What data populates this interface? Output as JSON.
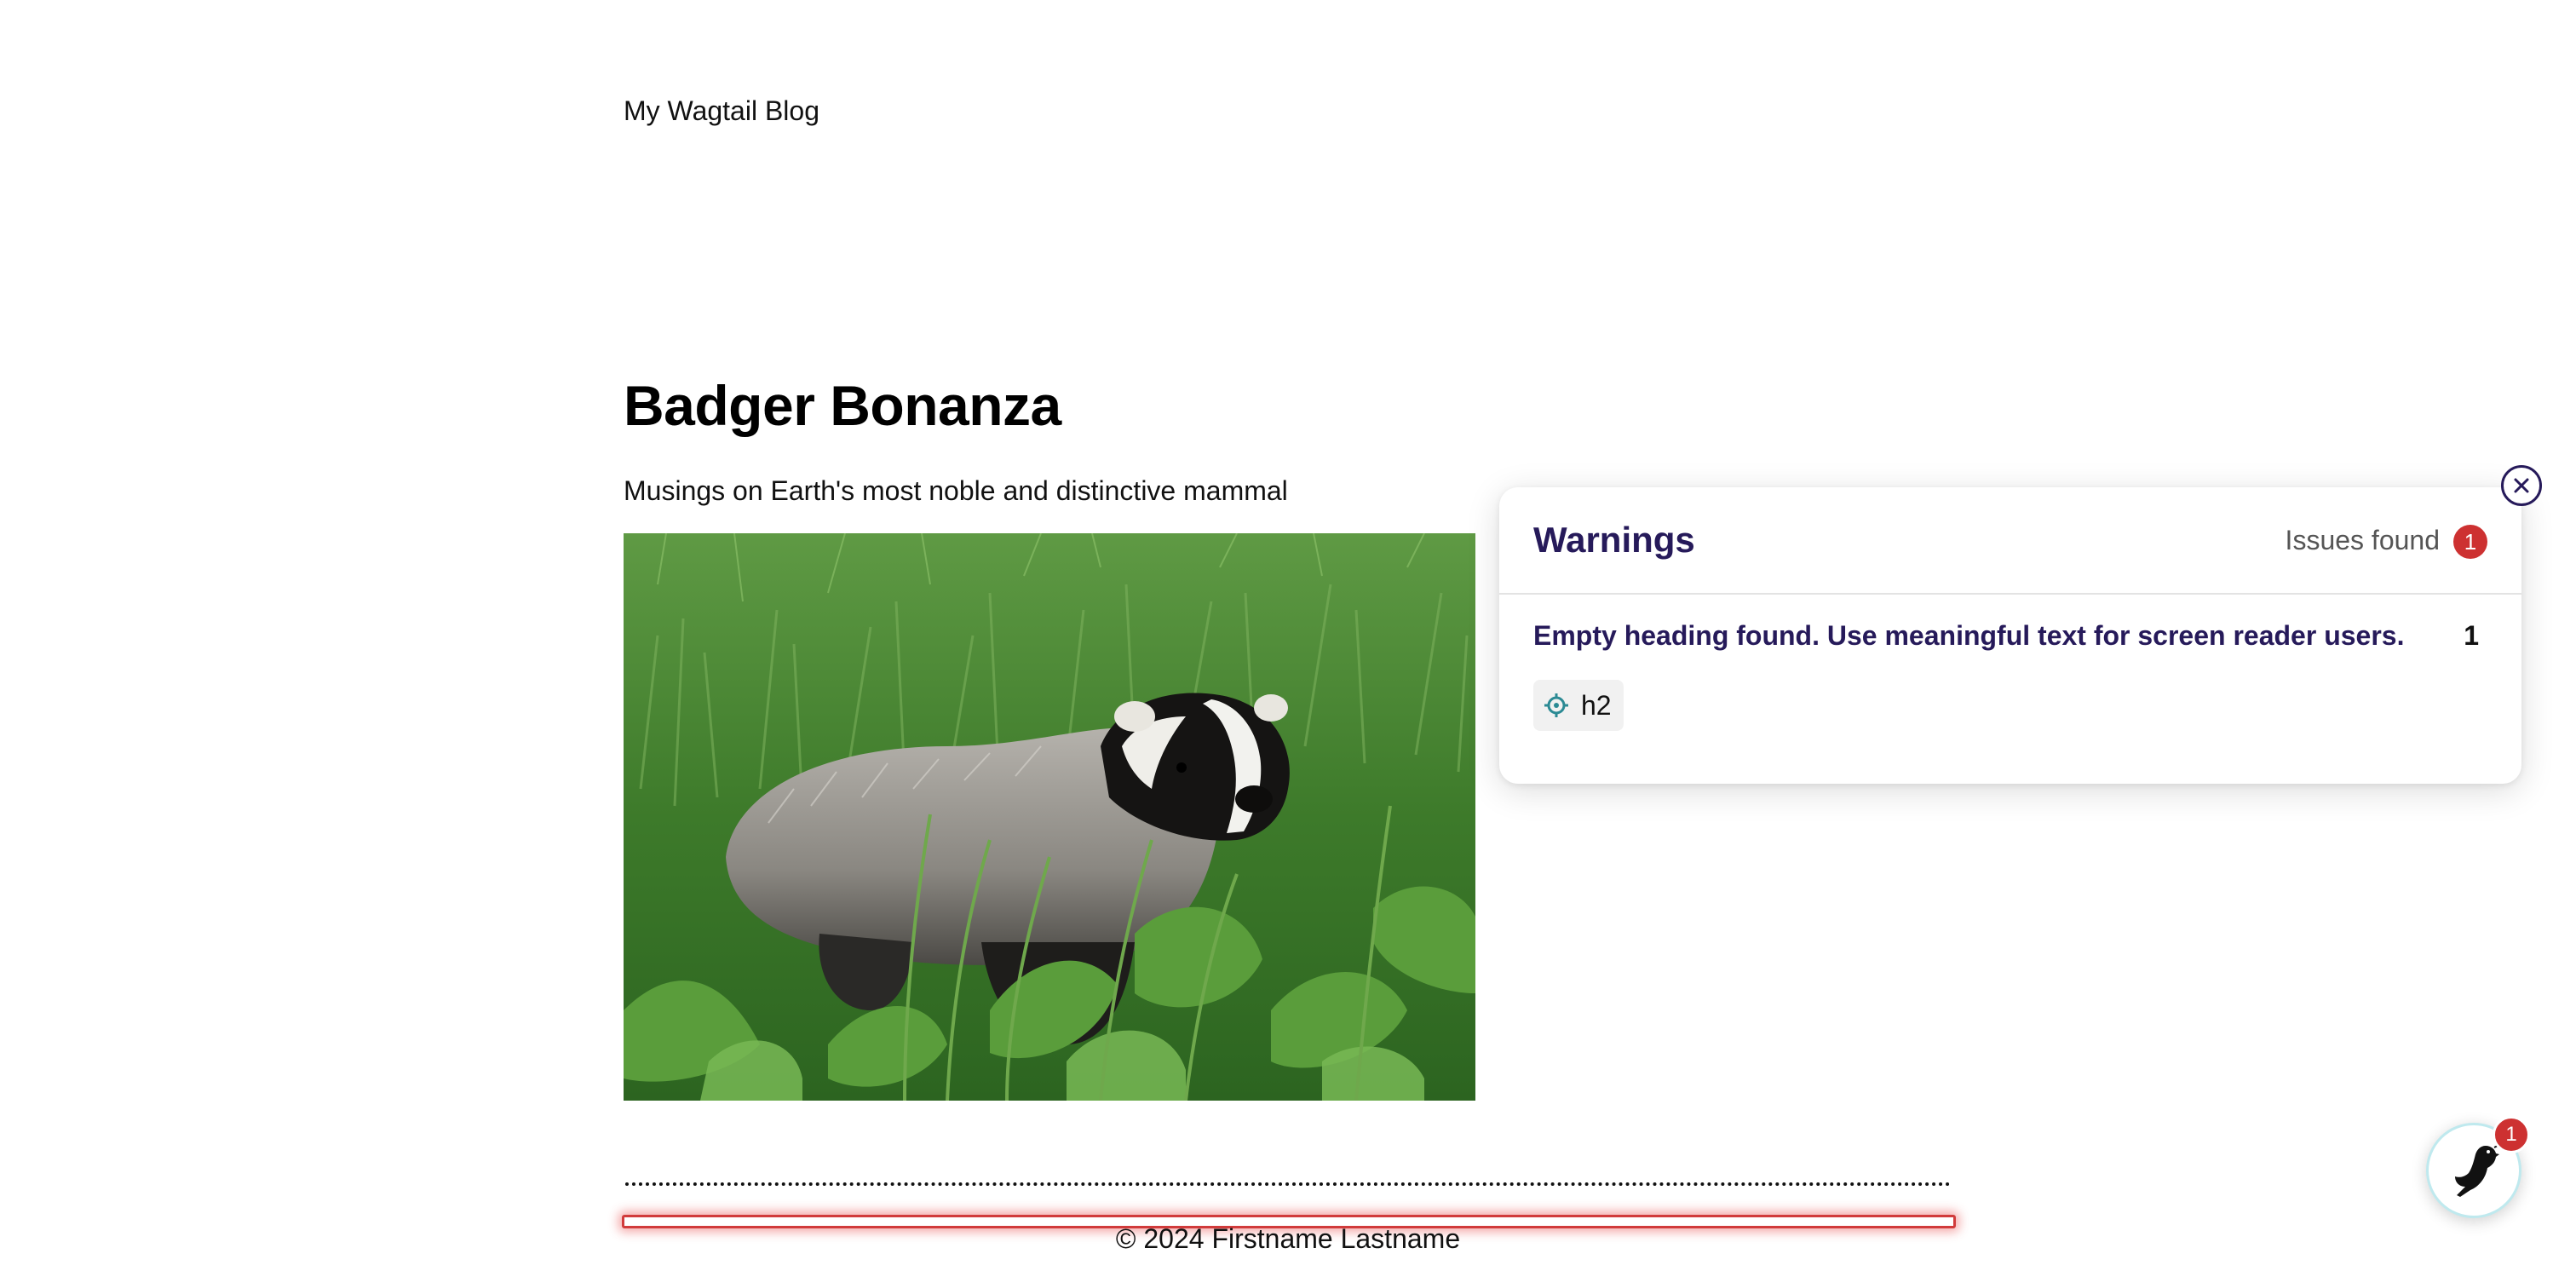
{
  "header": {
    "site_name": "My Wagtail Blog"
  },
  "page": {
    "title": "Badger Bonanza",
    "intro": "Musings on Earth's most noble and distinctive mammal",
    "image_alt": "European badger in tall green grass"
  },
  "footer": {
    "copyright": "© 2024 Firstname Lastname"
  },
  "a11y_panel": {
    "title": "Warnings",
    "issues_label": "Issues found",
    "issues_count": "1",
    "issue": {
      "message": "Empty heading found. Use meaningful text for screen reader users.",
      "count": "1",
      "element_tag": "h2"
    },
    "close_label": "Close"
  },
  "userbar": {
    "badge_count": "1",
    "button_label": "View Wagtail quick actions"
  },
  "colors": {
    "panel_title": "#261a5a",
    "badge": "#cd3131",
    "crosshair": "#2b8a94",
    "empty_heading_outline": "#d13b3b"
  },
  "icons": {
    "close": "close-circle-icon",
    "target": "crosshair-icon",
    "wagtail": "wagtail-bird-icon"
  }
}
